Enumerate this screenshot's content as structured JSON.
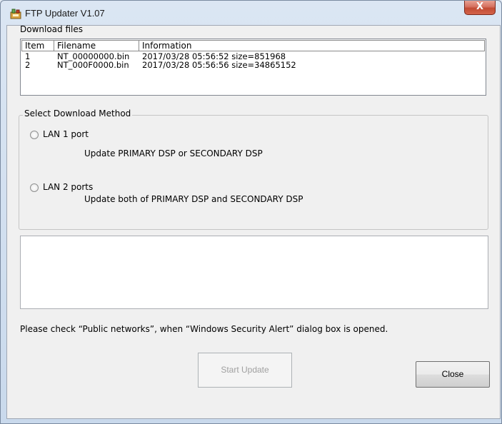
{
  "window": {
    "title": "FTP Updater V1.07",
    "close_glyph": "X"
  },
  "download": {
    "section_label": "Download files",
    "columns": [
      "Item",
      "Filename",
      "Information"
    ],
    "rows": [
      {
        "item": "1",
        "filename": "NT_00000000.bin",
        "information": "2017/03/28 05:56:52 size=851968"
      },
      {
        "item": "2",
        "filename": "NT_000F0000.bin",
        "information": "2017/03/28 05:56:56 size=34865152"
      }
    ]
  },
  "method": {
    "group_label": "Select Download Method",
    "options": [
      {
        "label": "LAN 1 port",
        "description": "Update PRIMARY DSP or SECONDARY DSP",
        "selected": false
      },
      {
        "label": "LAN 2 ports",
        "description": "Update both of PRIMARY DSP and SECONDARY DSP",
        "selected": false
      }
    ]
  },
  "status": {
    "log_text": ""
  },
  "notice": "Please check “Public networks”, when “Windows Security Alert” dialog box is opened.",
  "buttons": {
    "start_update": "Start Update",
    "close": "Close"
  },
  "icons": {
    "app": "app-updater-icon",
    "close": "close-icon",
    "radio": "radio-button-icon"
  }
}
